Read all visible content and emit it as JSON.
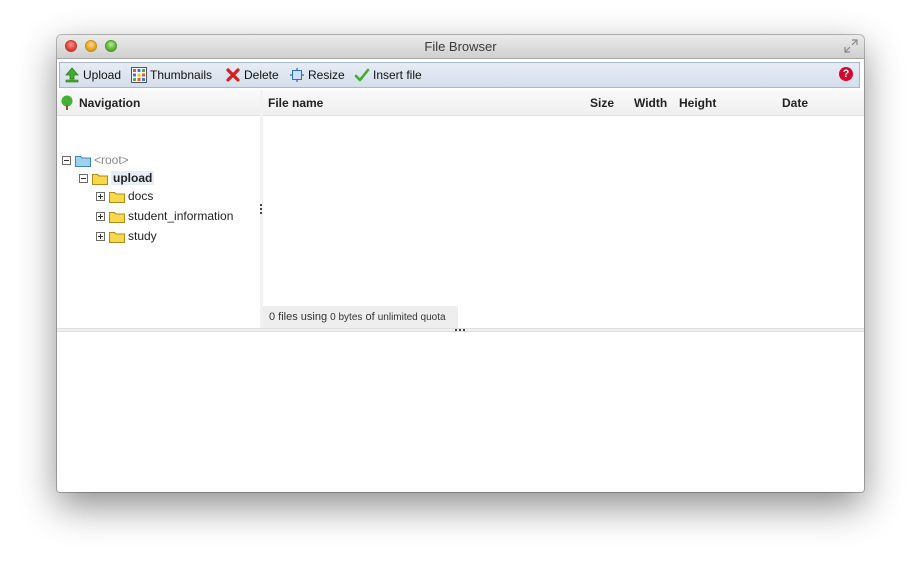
{
  "window": {
    "title": "File Browser"
  },
  "toolbar": {
    "upload": "Upload",
    "thumbnails": "Thumbnails",
    "delete": "Delete",
    "resize": "Resize",
    "insert_file": "Insert file",
    "help": "?"
  },
  "navigation": {
    "title": "Navigation",
    "root": "<root>",
    "upload": "upload",
    "folders": [
      "docs",
      "student_information",
      "study"
    ]
  },
  "files": {
    "columns": {
      "name": "File name",
      "size": "Size",
      "width": "Width",
      "height": "Height",
      "date": "Date"
    },
    "status": {
      "files_text": "0 files using",
      "bytes": "0 bytes",
      "of": "of",
      "quota": "unlimited quota"
    }
  },
  "colors": {
    "toolbar_bg": "#d5deec",
    "help": "#d6082c",
    "folder": "#f7d84a"
  }
}
